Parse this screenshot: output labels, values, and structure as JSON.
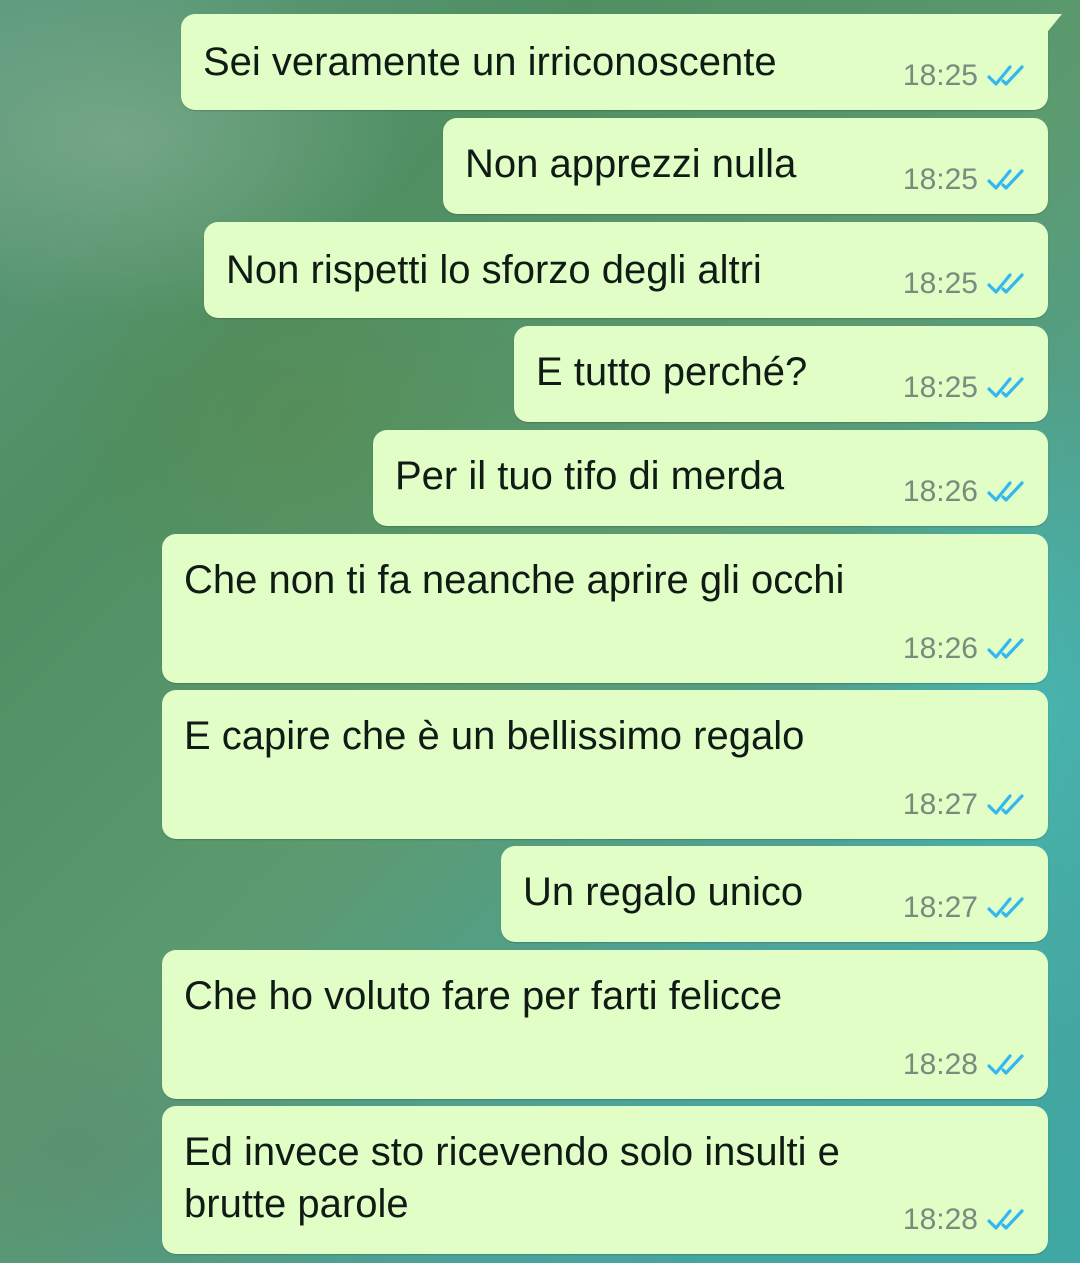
{
  "chat": {
    "messages": [
      {
        "text": "Sei veramente un irriconoscente",
        "time": "18:25",
        "status": "read-double-check-icon"
      },
      {
        "text": "Non apprezzi nulla",
        "time": "18:25",
        "status": "read-double-check-icon"
      },
      {
        "text": "Non rispetti lo sforzo degli altri",
        "time": "18:25",
        "status": "read-double-check-icon"
      },
      {
        "text": "E tutto perché?",
        "time": "18:25",
        "status": "read-double-check-icon"
      },
      {
        "text": "Per il tuo tifo di merda",
        "time": "18:26",
        "status": "read-double-check-icon"
      },
      {
        "text": "Che non ti fa neanche aprire gli occhi",
        "time": "18:26",
        "status": "read-double-check-icon"
      },
      {
        "text": "E capire che è un bellissimo regalo",
        "time": "18:27",
        "status": "read-double-check-icon"
      },
      {
        "text": "Un regalo unico",
        "time": "18:27",
        "status": "read-double-check-icon"
      },
      {
        "text": "Che ho voluto fare per farti felicce",
        "time": "18:28",
        "status": "read-double-check-icon"
      },
      {
        "text": "Ed invece sto ricevendo solo insulti e\nbrutte parole",
        "time": "18:28",
        "status": "read-double-check-icon"
      }
    ]
  },
  "colors": {
    "outgoing_bubble": "#e1fec6",
    "read_ticks": "#34b7f1",
    "time_text": "#7b8a7f"
  }
}
